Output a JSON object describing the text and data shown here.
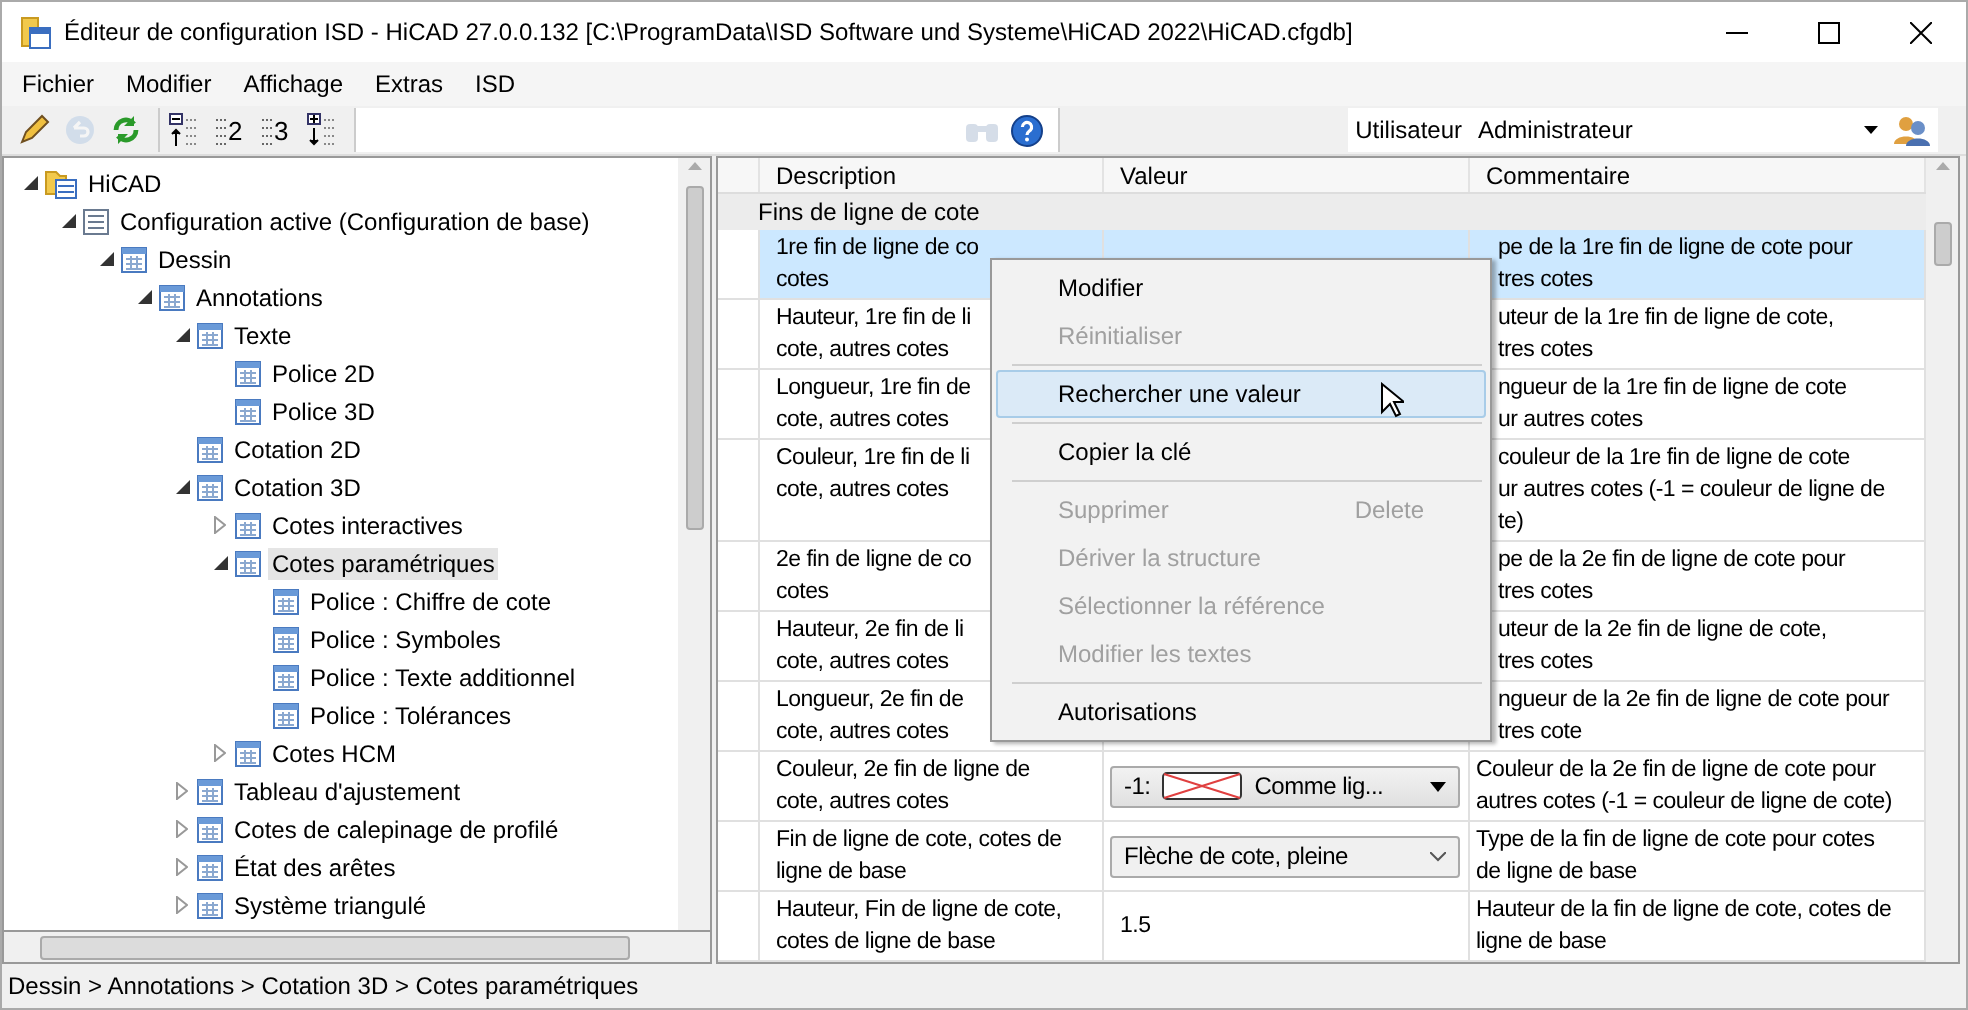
{
  "window": {
    "title": "Éditeur de configuration ISD  - HiCAD 27.0.0.132 [C:\\ProgramData\\ISD Software und Systeme\\HiCAD 2022\\HiCAD.cfgdb]"
  },
  "menu_bar": [
    "Fichier",
    "Modifier",
    "Affichage",
    "Extras",
    "ISD"
  ],
  "toolbar": [
    {
      "kind": "pencil",
      "disabled": false
    },
    {
      "kind": "undo",
      "disabled": true
    },
    {
      "kind": "refresh",
      "disabled": false
    },
    {
      "kind": "collapse",
      "disabled": false
    },
    {
      "kind": "level",
      "label": "2",
      "disabled": false
    },
    {
      "kind": "level",
      "label": "3",
      "disabled": false
    },
    {
      "kind": "expand",
      "disabled": false
    },
    {
      "kind": "find",
      "disabled": true
    },
    {
      "kind": "help",
      "disabled": false
    }
  ],
  "user": {
    "label": "Utilisateur",
    "value": "Administrateur"
  },
  "tree": [
    {
      "label": "HiCAD",
      "expanded": true,
      "selected": false,
      "children": [
        {
          "label": "Configuration active (Configuration de base)",
          "expanded": true,
          "selected": false,
          "children": [
            {
              "label": "Dessin",
              "expanded": true,
              "selected": false,
              "children": [
                {
                  "label": "Annotations",
                  "expanded": true,
                  "selected": false,
                  "children": [
                    {
                      "label": "Texte",
                      "expanded": true,
                      "selected": false,
                      "children": [
                        {
                          "label": "Police 2D",
                          "selected": false
                        },
                        {
                          "label": "Police 3D",
                          "selected": false
                        }
                      ]
                    },
                    {
                      "label": "Cotation 2D",
                      "selected": false
                    },
                    {
                      "label": "Cotation 3D",
                      "expanded": true,
                      "selected": false,
                      "children": [
                        {
                          "label": "Cotes interactives",
                          "expanded": false,
                          "selected": false
                        },
                        {
                          "label": "Cotes paramétriques",
                          "expanded": true,
                          "selected": true,
                          "children": [
                            {
                              "label": "Police : Chiffre de cote",
                              "selected": false
                            },
                            {
                              "label": "Police : Symboles",
                              "selected": false
                            },
                            {
                              "label": "Police : Texte additionnel",
                              "selected": false
                            },
                            {
                              "label": "Police : Tolérances",
                              "selected": false
                            }
                          ]
                        },
                        {
                          "label": "Cotes HCM",
                          "expanded": false,
                          "selected": false
                        }
                      ]
                    },
                    {
                      "label": "Tableau d'ajustement",
                      "expanded": false,
                      "selected": false
                    },
                    {
                      "label": "Cotes de calepinage de profilé",
                      "expanded": false,
                      "selected": false
                    },
                    {
                      "label": "État des arêtes",
                      "expanded": false,
                      "selected": false
                    },
                    {
                      "label": "Système triangulé",
                      "expanded": false,
                      "selected": false
                    }
                  ]
                }
              ]
            }
          ]
        }
      ]
    }
  ],
  "status_bar": "Dessin > Annotations > Cotation 3D > Cotes paramétriques",
  "table": {
    "columns": [
      "Description",
      "Valeur",
      "Commentaire"
    ],
    "group": "Fins de ligne de cote",
    "rows": [
      {
        "description": "1re fin de ligne de co\ncotes",
        "comment": "pe de la 1re fin de ligne de cote pour\ntres cotes",
        "selected": true,
        "partly_hidden": true
      },
      {
        "description": "Hauteur, 1re fin de li\ncote, autres cotes",
        "comment": "uteur de la 1re fin de ligne de cote,\ntres cotes",
        "selected": false,
        "partly_hidden": true
      },
      {
        "description": "Longueur, 1re fin de\ncote, autres cotes",
        "comment": "ngueur de la 1re fin de ligne de cote\nur autres cotes",
        "selected": false,
        "partly_hidden": true
      },
      {
        "description": "Couleur, 1re fin de li\ncote, autres cotes",
        "comment": "couleur de la 1re fin de ligne de cote\nur autres cotes (-1 = couleur de ligne de\nte)",
        "selected": false,
        "partly_hidden": true
      },
      {
        "description": "2e fin de ligne de co\ncotes",
        "comment": "pe de la 2e fin de ligne de cote pour\ntres cotes",
        "selected": false,
        "partly_hidden": true
      },
      {
        "description": "Hauteur, 2e fin de li\ncote, autres cotes",
        "comment": "uteur de la 2e fin de ligne de cote,\ntres cotes",
        "selected": false,
        "partly_hidden": true
      },
      {
        "description": "Longueur, 2e fin de\ncote, autres cotes",
        "comment": "ngueur de la 2e fin de ligne de cote pour\ntres cote",
        "selected": false,
        "partly_hidden": true
      },
      {
        "description": "Couleur, 2e fin de ligne de\ncote, autres cotes",
        "value": {
          "kind": "color",
          "index": "-1:",
          "text": "Comme lig..."
        },
        "comment": "Couleur de la 2e fin de ligne de cote pour\nautres cotes (-1 = couleur de ligne de cote)",
        "selected": false,
        "partly_hidden": false
      },
      {
        "description": "Fin de ligne de cote, cotes de\nligne de base",
        "value": {
          "kind": "choice",
          "text": "Flèche de cote, pleine"
        },
        "comment": "Type de la fin de ligne de cote pour cotes\nde ligne de base",
        "selected": false,
        "partly_hidden": false
      },
      {
        "description": "Hauteur, Fin de ligne de cote,\ncotes de ligne de base",
        "value": {
          "kind": "text",
          "text": "1.5"
        },
        "comment": "Hauteur de la fin de ligne de cote, cotes de\nligne de base",
        "selected": false,
        "partly_hidden": false
      }
    ]
  },
  "context_menu": [
    {
      "kind": "item",
      "label": "Modifier",
      "disabled": false,
      "selected": false
    },
    {
      "kind": "item",
      "label": "Réinitialiser",
      "disabled": true,
      "selected": false
    },
    {
      "kind": "separator"
    },
    {
      "kind": "item",
      "label": "Rechercher une valeur",
      "disabled": false,
      "selected": true
    },
    {
      "kind": "separator"
    },
    {
      "kind": "item",
      "label": "Copier la clé",
      "disabled": false,
      "selected": false
    },
    {
      "kind": "separator"
    },
    {
      "kind": "item",
      "label": "Supprimer",
      "shortcut": "Delete",
      "disabled": true,
      "selected": false
    },
    {
      "kind": "item",
      "label": "Dériver la structure",
      "disabled": true,
      "selected": false
    },
    {
      "kind": "item",
      "label": "Sélectionner la référence",
      "disabled": true,
      "selected": false
    },
    {
      "kind": "item",
      "label": "Modifier les textes",
      "disabled": true,
      "selected": false
    },
    {
      "kind": "separator"
    },
    {
      "kind": "item",
      "label": "Autorisations",
      "disabled": false,
      "selected": false
    }
  ]
}
